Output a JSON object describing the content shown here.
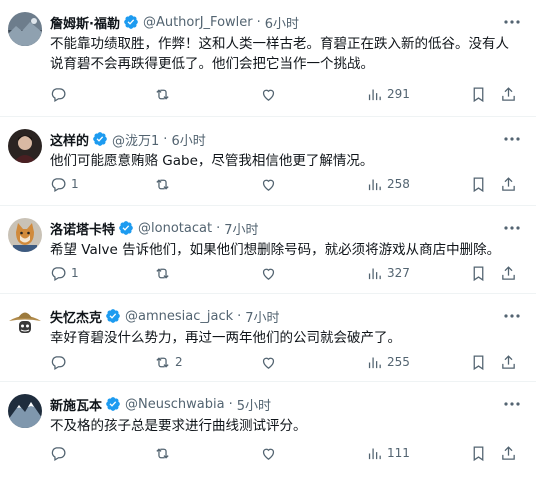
{
  "colors": {
    "verified": "#1d9bf0",
    "muted": "#536471",
    "text": "#0f1419",
    "divider": "#eff3f4"
  },
  "tweets": [
    {
      "name": "詹姆斯·福勒",
      "handle": "@AuthorJ_Fowler",
      "sep": "·",
      "time": "6小时",
      "text": "不能靠功绩取胜，作弊！这和人类一样古老。育碧正在跌入新的低谷。没有人\n说育碧不会再跌得更低了。他们会把它当作一个挑战。",
      "replies": "",
      "reposts": "",
      "likes": "",
      "views": "291",
      "avatar_icon": "landscape-avatar"
    },
    {
      "name": "这样的",
      "handle": "@泷万1",
      "sep": "·",
      "time": "6小时",
      "text": "他们可能愿意贿赂 Gabe，尽管我相信他更了解情况。",
      "replies": "1",
      "reposts": "",
      "likes": "",
      "views": "258",
      "avatar_icon": "portrait-avatar"
    },
    {
      "name": "洛诺塔卡特",
      "handle": "@lonotacat",
      "sep": "·",
      "time": "7小时",
      "text": "希望 Valve 告诉他们，如果他们想删除号码，就必须将游戏从商店中删除。",
      "replies": "1",
      "reposts": "",
      "likes": "",
      "views": "327",
      "avatar_icon": "cat-avatar"
    },
    {
      "name": "失忆杰克",
      "handle": "@amnesiac_jack",
      "sep": "·",
      "time": "7小时",
      "text": "幸好育碧没什么势力，再过一两年他们的公司就会破产了。",
      "replies": "",
      "reposts": "2",
      "likes": "",
      "views": "255",
      "avatar_icon": "straw-hat-avatar"
    },
    {
      "name": "新施瓦本",
      "handle": "@Neuschwabia",
      "sep": "·",
      "time": "5小时",
      "text": "不及格的孩子总是要求进行曲线测试评分。",
      "replies": "",
      "reposts": "",
      "likes": "",
      "views": "111",
      "avatar_icon": "mountain-avatar"
    }
  ]
}
